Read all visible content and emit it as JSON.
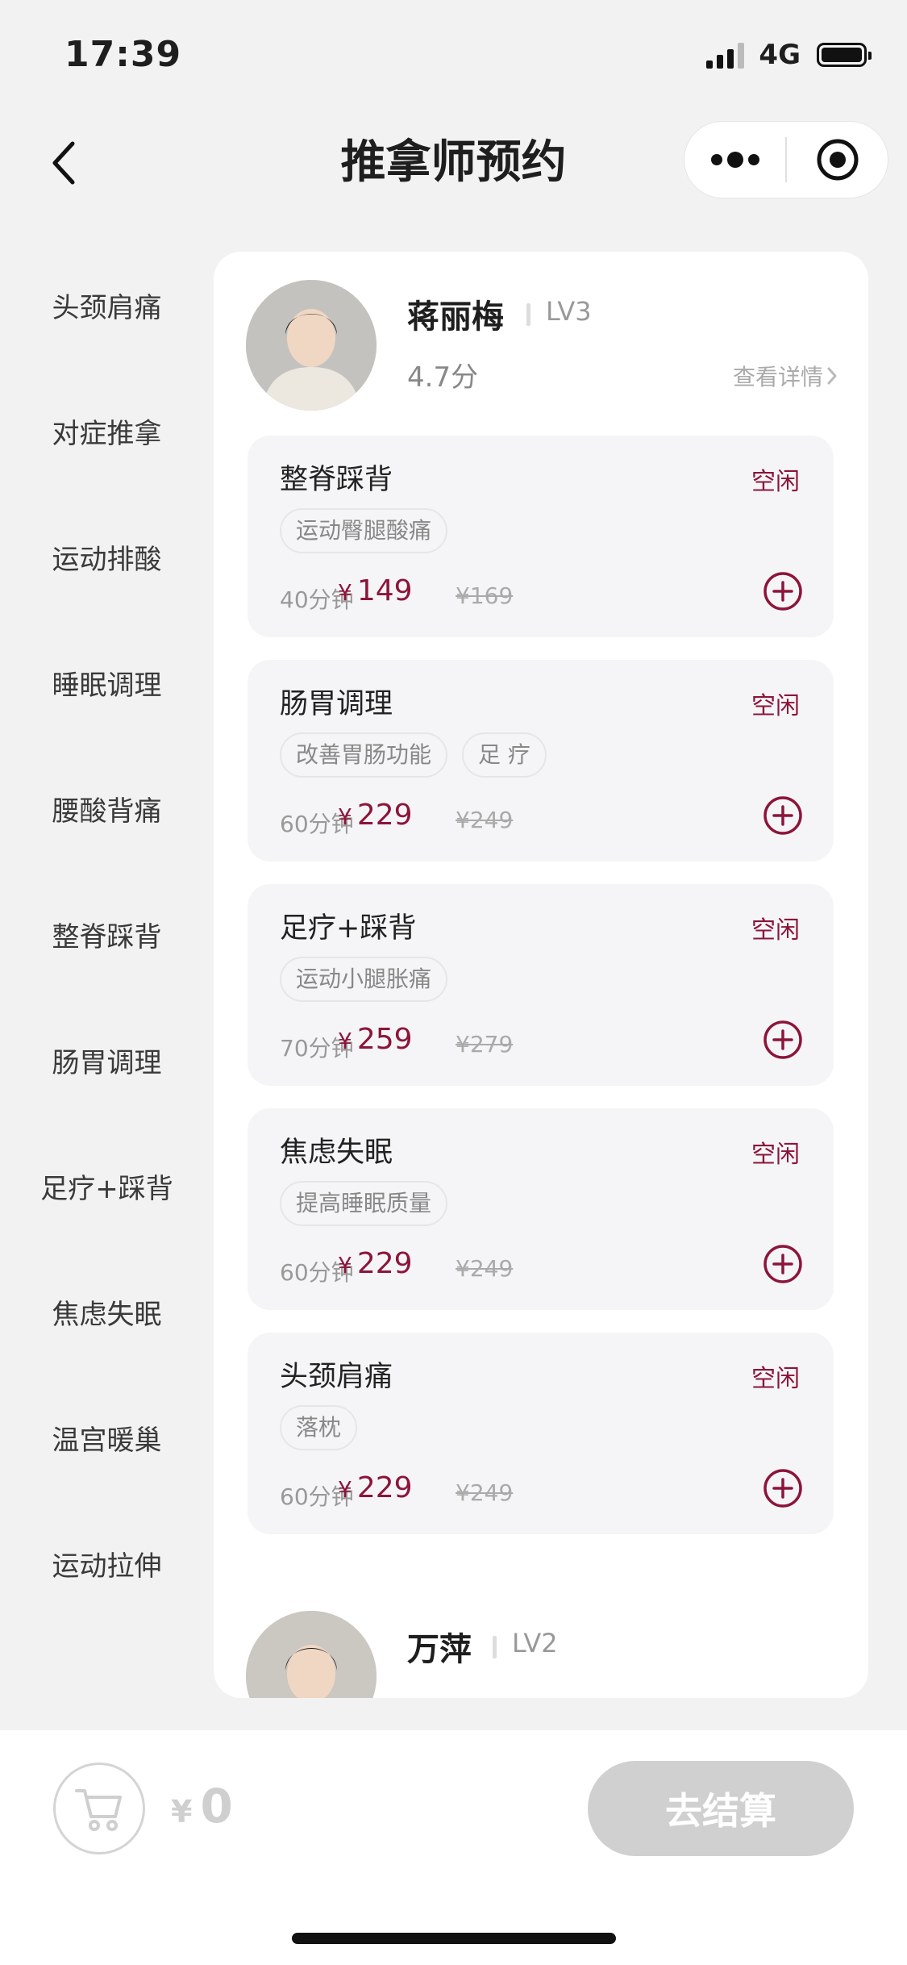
{
  "status_bar": {
    "time": "17:39",
    "network": "4G"
  },
  "nav": {
    "title": "推拿师预约"
  },
  "sidebar": {
    "items": [
      {
        "label": "头颈肩痛"
      },
      {
        "label": "对症推拿"
      },
      {
        "label": "运动排酸"
      },
      {
        "label": "睡眠调理"
      },
      {
        "label": "腰酸背痛"
      },
      {
        "label": "整脊踩背"
      },
      {
        "label": "肠胃调理"
      },
      {
        "label": "足疗+踩背"
      },
      {
        "label": "焦虑失眠"
      },
      {
        "label": "温宫暖巢"
      },
      {
        "label": "运动拉伸"
      }
    ]
  },
  "therapists": [
    {
      "name": "蒋丽梅",
      "level": "LV3",
      "rating": "4.7分",
      "details_label": "查看详情",
      "services": [
        {
          "name": "整脊踩背",
          "status": "空闲",
          "tags": [
            "运动臀腿酸痛"
          ],
          "duration": "40分钟",
          "currency": "¥",
          "price": "149",
          "original_price": "¥169"
        },
        {
          "name": "肠胃调理",
          "status": "空闲",
          "tags": [
            "改善胃肠功能",
            "足 疗"
          ],
          "duration": "60分钟",
          "currency": "¥",
          "price": "229",
          "original_price": "¥249"
        },
        {
          "name": "足疗+踩背",
          "status": "空闲",
          "tags": [
            "运动小腿胀痛"
          ],
          "duration": "70分钟",
          "currency": "¥",
          "price": "259",
          "original_price": "¥279"
        },
        {
          "name": "焦虑失眠",
          "status": "空闲",
          "tags": [
            "提高睡眠质量"
          ],
          "duration": "60分钟",
          "currency": "¥",
          "price": "229",
          "original_price": "¥249"
        },
        {
          "name": "头颈肩痛",
          "status": "空闲",
          "tags": [
            "落枕"
          ],
          "duration": "60分钟",
          "currency": "¥",
          "price": "229",
          "original_price": "¥249"
        }
      ]
    },
    {
      "name": "万萍",
      "level": "LV2"
    }
  ],
  "cart": {
    "currency": "¥",
    "total": "0",
    "checkout_label": "去结算"
  },
  "colors": {
    "accent": "#8c1539",
    "background": "#f2f2f2",
    "card": "#f5f5f7"
  }
}
